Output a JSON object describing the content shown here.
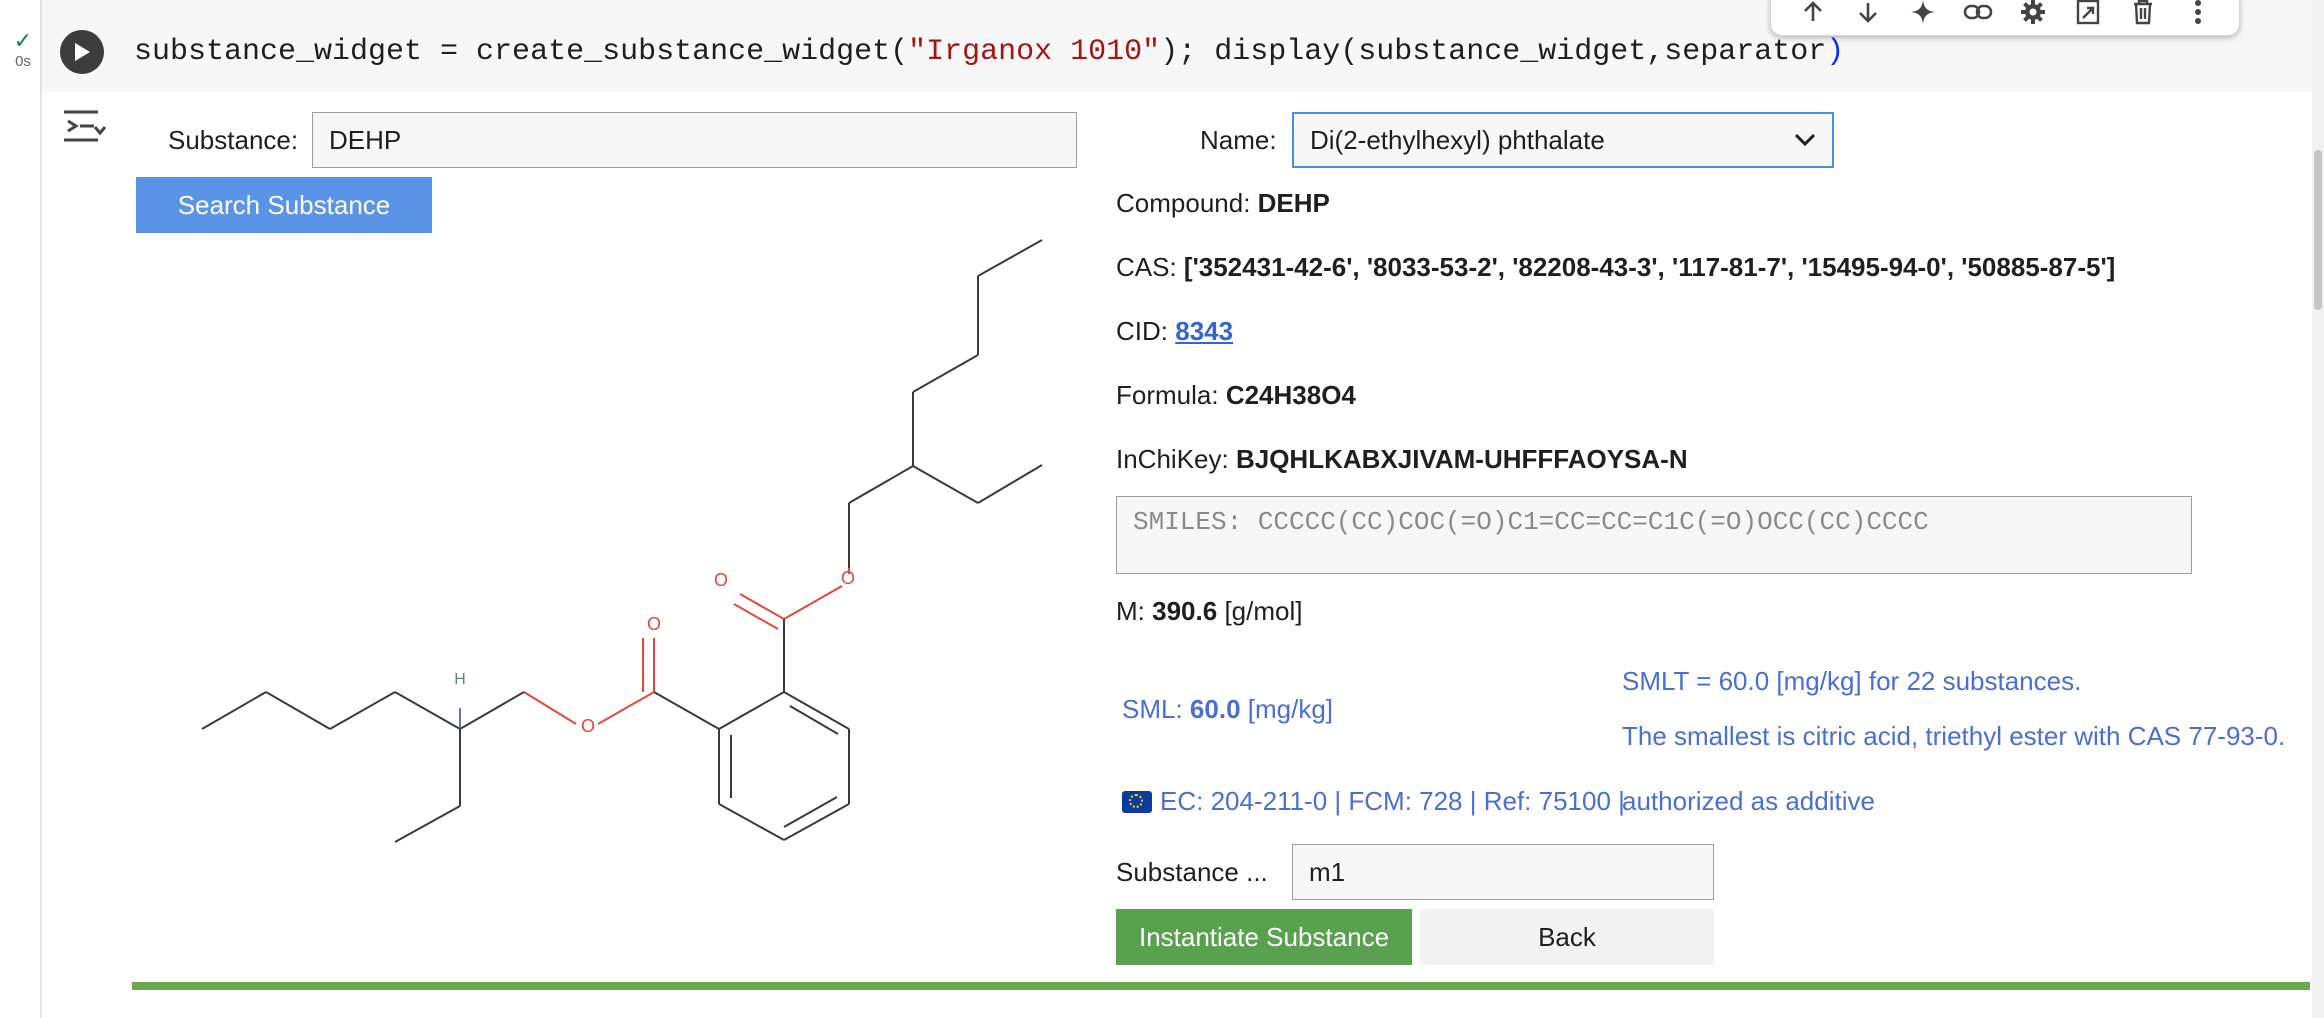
{
  "cell": {
    "status_check": "✓",
    "exec_time": "0s",
    "code": {
      "part1": "substance_widget = create_substance_widget(",
      "string": "\"Irganox 1010\"",
      "part2": "); display(substance_widget,separator",
      "paren_close": ")"
    },
    "toolbar_icons": [
      "arrow-up-icon",
      "arrow-down-icon",
      "sparkle-icon",
      "link-icon",
      "gear-icon",
      "mirror-cell-icon",
      "trash-icon",
      "more-vert-icon"
    ]
  },
  "widget": {
    "substance_label": "Substance:",
    "substance_value": "DEHP",
    "search_button": "Search Substance",
    "name_label": "Name:",
    "name_selected": "Di(2-ethylhexyl) phthalate",
    "compound_label": "Compound:",
    "compound_value": "DEHP",
    "cas_label": "CAS:",
    "cas_value": "['352431-42-6', '8033-53-2', '82208-43-3', '117-81-7', '15495-94-0', '50885-87-5']",
    "cid_label": "CID:",
    "cid_value": "8343",
    "formula_label": "Formula:",
    "formula_value": "C24H38O4",
    "inchikey_label": "InChiKey:",
    "inchikey_value": "BJQHLKABXJIVAM-UHFFFAOYSA-N",
    "smiles_text": "SMILES: CCCCC(CC)COC(=O)C1=CC=CC=C1C(=O)OCC(CC)CCCC",
    "m_label": "M:",
    "m_value": "390.6",
    "m_unit": "[g/mol]",
    "sml_label": "SML:",
    "sml_value": "60.0",
    "sml_unit": "[mg/kg]",
    "smlt_text": "SMLT = 60.0 [mg/kg] for 22 substances.",
    "smallest_text": "The smallest is citric acid, triethyl ester with CAS 77-93-0.",
    "ec_text": "EC: 204-211-0 | FCM: 728 | Ref: 75100 |",
    "authorized_text": "authorized as additive",
    "instance_label": "Substance ...",
    "instance_value": "m1",
    "instantiate_button": "Instantiate Substance",
    "back_button": "Back"
  },
  "molecule": {
    "atom_labels": [
      "O",
      "O",
      "O",
      "O",
      "H"
    ],
    "colors": {
      "oxygen": "#e0483e",
      "hydrogen": "#5c7f95",
      "bond": "#3a3a3a"
    }
  },
  "colors": {
    "search_button": "#5b94e6",
    "instantiate_button": "#59a14f",
    "separator": "#6aaa4f",
    "info_blue": "#4a6fd0",
    "link": "#3366cc"
  }
}
